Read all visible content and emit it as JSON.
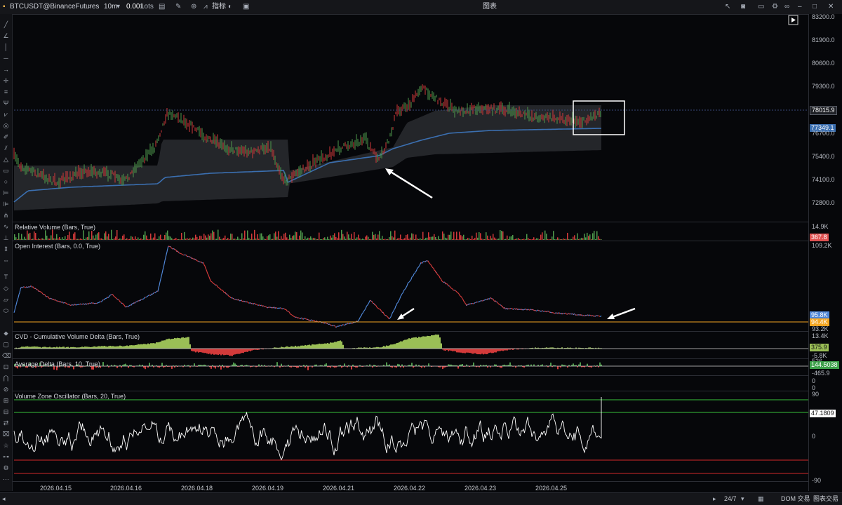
{
  "toolbar": {
    "symbol": "BTCUSDT@BinanceFutures",
    "interval": "10m",
    "lots": "0.001",
    "lots_unit": "Lots",
    "indicators_label": "指标",
    "title": "图表"
  },
  "price_axis": [
    "83200.0",
    "81900.0",
    "80600.0",
    "79300.0",
    "78015.9",
    "76700.0",
    "75400.0",
    "74100.0",
    "72800.0"
  ],
  "price_tags": {
    "last": "78015.9",
    "vwap": "77349.1"
  },
  "panes": {
    "rel_volume": {
      "title": "Relative Volume (Bars, True)",
      "top_label": "14.9K",
      "tag": "367.8"
    },
    "open_interest": {
      "title": "Open Interest (Bars, 0.0, True)",
      "top_label": "109.2K",
      "tag_blue": "95.8K",
      "tag_orange": "94.4K",
      "bottom_label": "93.2K"
    },
    "cvd": {
      "title": "CVD - Cumulative Volume Delta (Bars, True)",
      "top_label": "13.4K",
      "tag": "375.9",
      "bottom_label": "-5.8K"
    },
    "avg_delta": {
      "title": "Average Delta (Bars, 10, True)",
      "top_label": "526",
      "tag": "144.5038",
      "bottom_label": "-465.9"
    },
    "blank": {
      "labels": [
        "0",
        "0"
      ]
    },
    "vzo": {
      "title": "Volume Zone Oscillator (Bars, 20, True)",
      "top_label": "90",
      "tag": "47.1809",
      "mid_label": "0",
      "bottom_label": "-90"
    }
  },
  "time_axis": [
    "2026.04.15",
    "2026.04.16",
    "2026.04.18",
    "2026.04.19",
    "2026.04.21",
    "2026.04.22",
    "2026.04.23",
    "2026.04.25"
  ],
  "statusbar": {
    "session": "24/7",
    "dom": "DOM 交易",
    "chart_trade": "图表交易"
  },
  "colors": {
    "bg": "#06070a",
    "vwap": "#3b6fb0",
    "band": "#2a2b30",
    "up": "#4f9a4c",
    "down": "#d23a3a",
    "oi": "#4f86d6",
    "cvd_up": "#9abe56",
    "vzo": "#ffffff",
    "green_line": "#38c23a",
    "red_line": "#d22a2a",
    "orange": "#f4a623"
  }
}
